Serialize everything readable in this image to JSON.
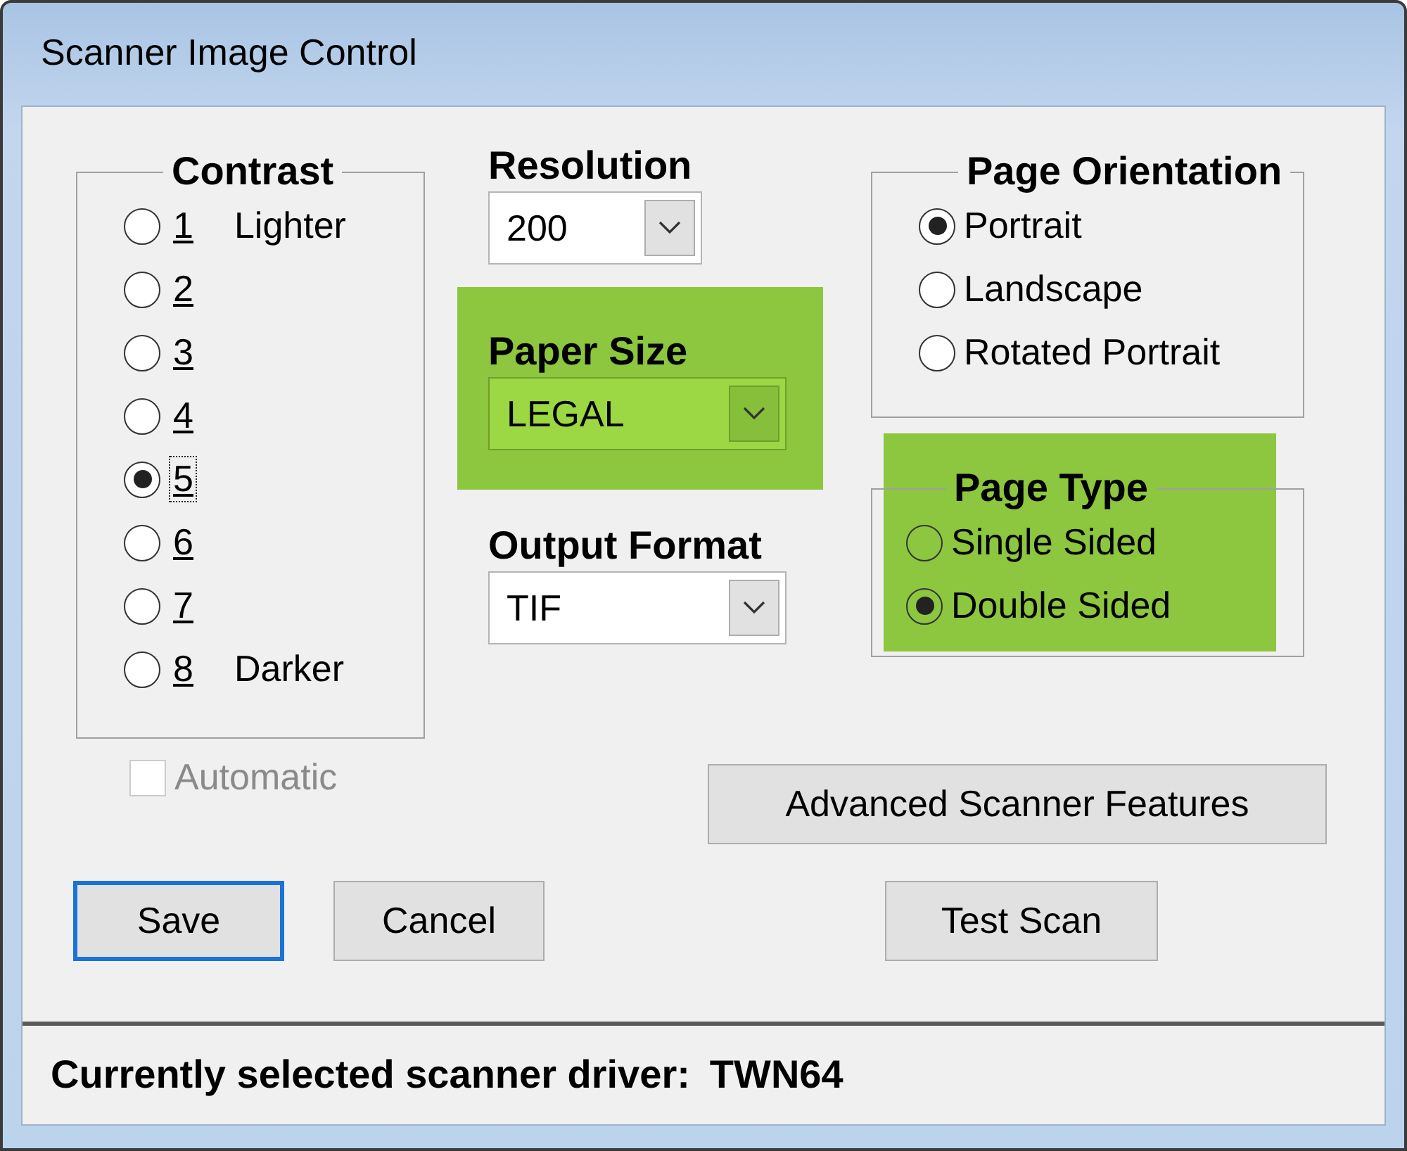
{
  "window": {
    "title": "Scanner Image Control"
  },
  "contrast": {
    "label": "Contrast",
    "options": [
      {
        "label": "1",
        "note": "Lighter",
        "selected": false,
        "focused": false
      },
      {
        "label": "2",
        "selected": false,
        "focused": false
      },
      {
        "label": "3",
        "selected": false,
        "focused": false
      },
      {
        "label": "4",
        "selected": false,
        "focused": false
      },
      {
        "label": "5",
        "selected": true,
        "focused": true
      },
      {
        "label": "6",
        "selected": false,
        "focused": false
      },
      {
        "label": "7",
        "selected": false,
        "focused": false
      },
      {
        "label": "8",
        "note": "Darker",
        "selected": false,
        "focused": false
      }
    ]
  },
  "automatic": {
    "label": "Automatic",
    "checked": false,
    "disabled": true
  },
  "resolution": {
    "label": "Resolution",
    "value": "200",
    "highlighted": false
  },
  "paper_size": {
    "label": "Paper Size",
    "value": "LEGAL",
    "highlighted": true
  },
  "output_format": {
    "label": "Output Format",
    "value": "TIF",
    "highlighted": false
  },
  "page_orientation": {
    "label": "Page Orientation",
    "highlighted": false,
    "options": [
      {
        "label": "Portrait",
        "selected": true
      },
      {
        "label": "Landscape",
        "selected": false
      },
      {
        "label": "Rotated Portrait",
        "selected": false
      }
    ]
  },
  "page_type": {
    "label": "Page Type",
    "highlighted": true,
    "options": [
      {
        "label": "Single Sided",
        "selected": false
      },
      {
        "label": "Double Sided",
        "selected": true
      }
    ]
  },
  "advanced_button": {
    "label": "Advanced Scanner Features",
    "default": false
  },
  "save_button": {
    "label": "Save",
    "default": true
  },
  "cancel_button": {
    "label": "Cancel",
    "default": false
  },
  "test_scan_button": {
    "label": "Test Scan",
    "default": false
  },
  "status_bar": {
    "label": "Currently selected scanner driver:",
    "value": "TWN64"
  }
}
